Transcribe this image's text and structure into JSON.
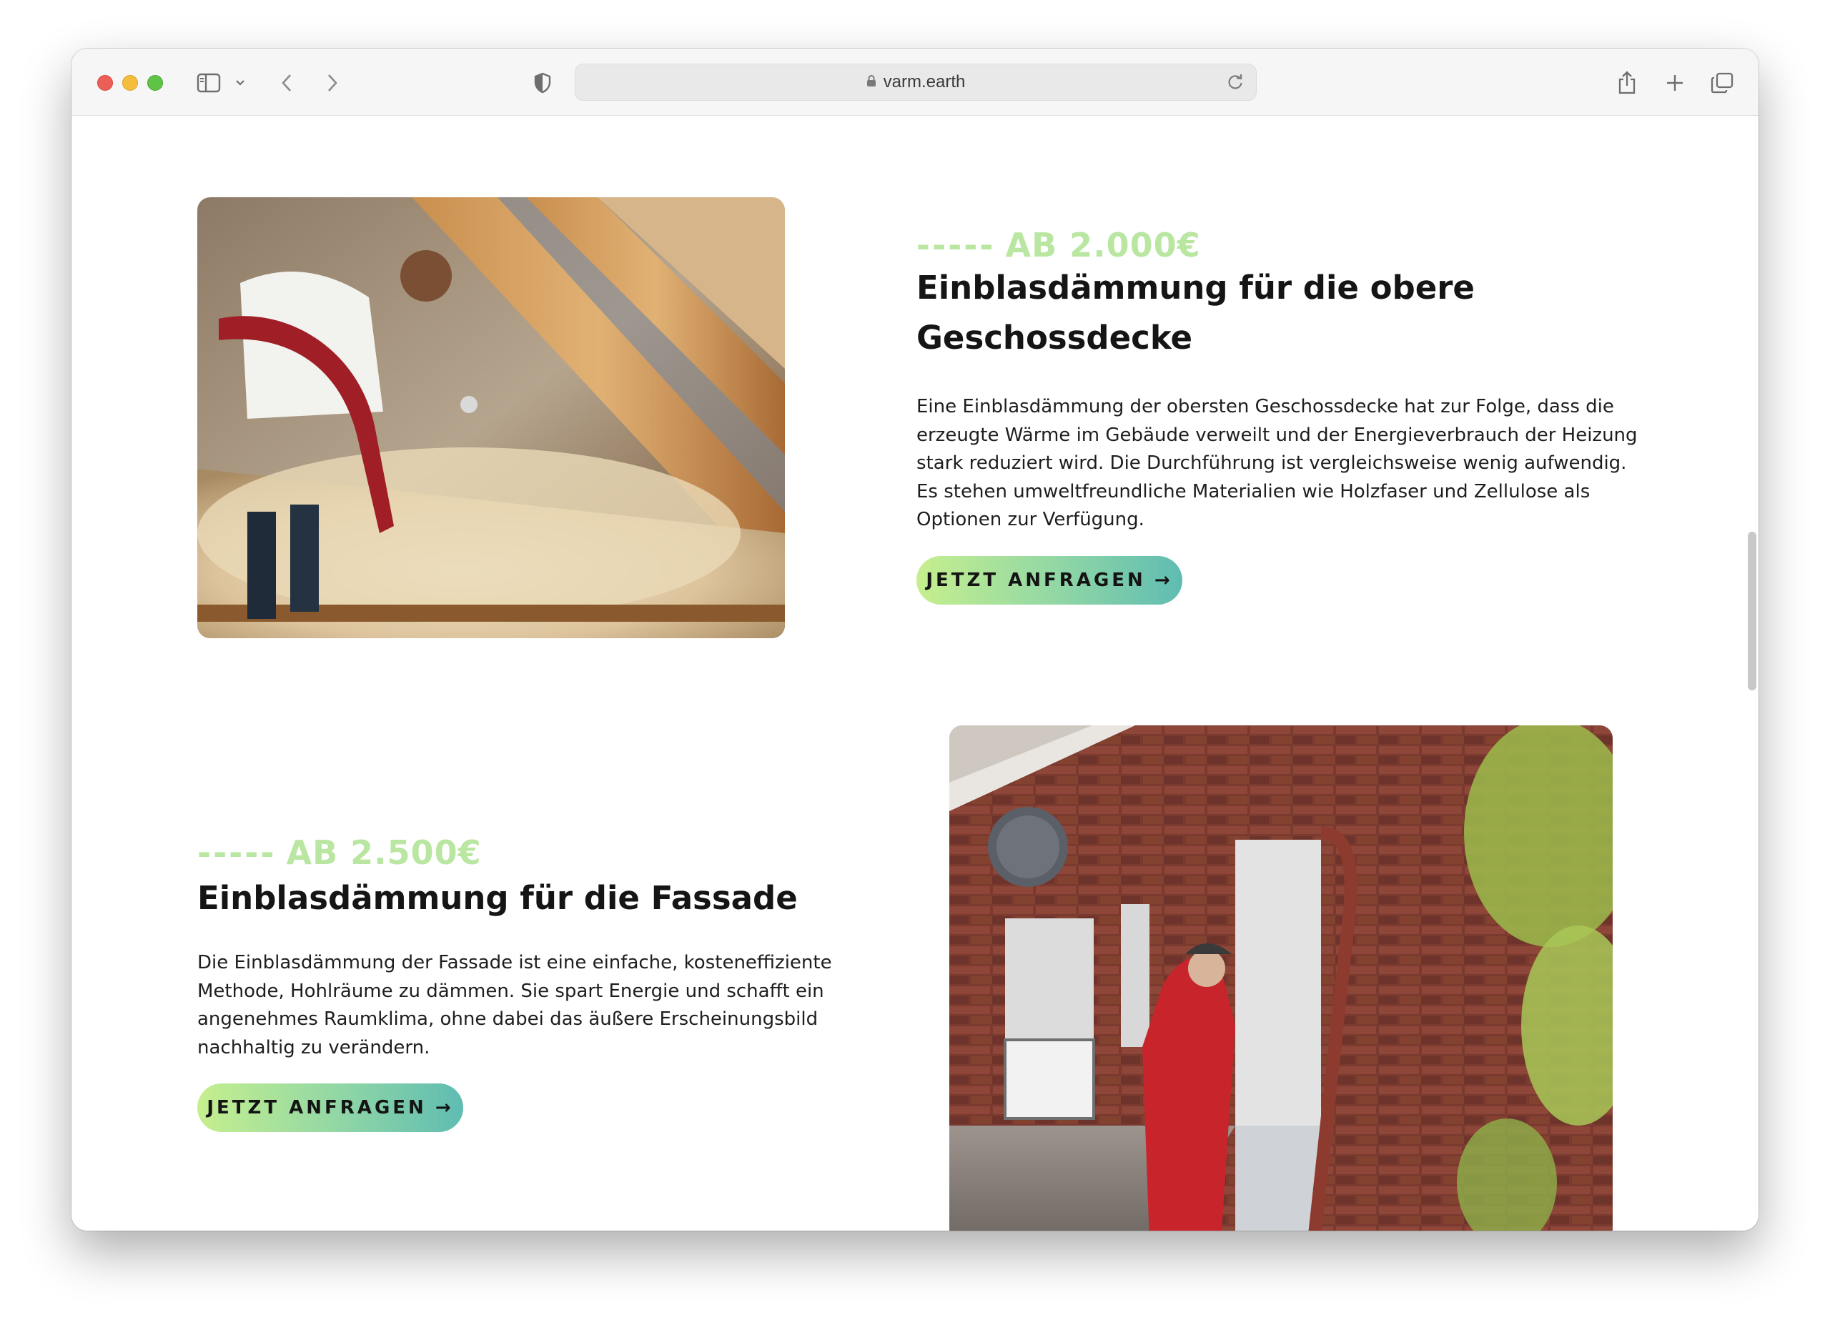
{
  "browser": {
    "url": "varm.earth"
  },
  "sections": [
    {
      "price_dashes": "-----",
      "price": "AB 2.000€",
      "title": "Einblasdämmung für die obere Geschossdecke",
      "description": "Eine Einblasdämmung der obersten Geschossdecke hat zur Folge, dass die erzeugte Wärme im Gebäude verweilt und der Energieverbrauch der Heizung stark reduziert wird. Die Durchführung ist vergleichsweise wenig aufwendig. Es stehen umweltfreundliche Materialien wie Holzfaser und Zellulose als Optionen zur Verfügung.",
      "cta_label": "JETZT ANFRAGEN",
      "cta_arrow": "→"
    },
    {
      "price_dashes": "-----",
      "price": "AB 2.500€",
      "title": "Einblasdämmung für die Fassade",
      "description": "Die Einblasdämmung der Fassade ist eine einfache, kosteneffiziente Methode, Hohlräume zu dämmen. Sie spart Energie und schafft ein angenehmes Raumklima, ohne dabei das äußere Erscheinungsbild nachhaltig zu verändern.",
      "cta_label": "JETZT ANFRAGEN",
      "cta_arrow": "→"
    }
  ],
  "colors": {
    "price_accent": "#b9e6a1",
    "button_gradient_start": "#c6ef8e",
    "button_gradient_end": "#5fbcb2",
    "heading": "#151515"
  }
}
